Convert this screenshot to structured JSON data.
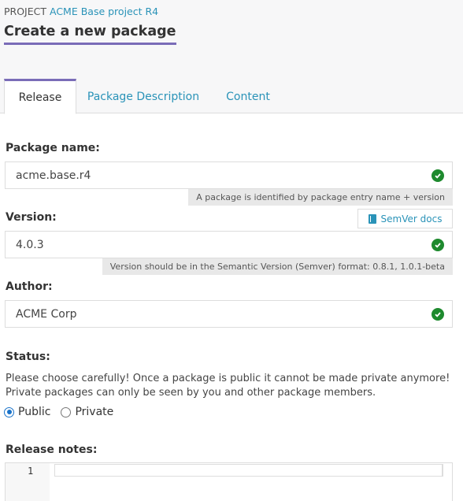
{
  "header": {
    "project_prefix": "PROJECT",
    "project_name": "ACME Base project R4",
    "title": "Create a new package"
  },
  "tabs": [
    {
      "label": "Release",
      "active": true
    },
    {
      "label": "Package Description",
      "active": false
    },
    {
      "label": "Content",
      "active": false
    }
  ],
  "form": {
    "package_name": {
      "label": "Package name:",
      "value": "acme.base.r4",
      "hint": "A package is identified by package entry name + version"
    },
    "version": {
      "label": "Version:",
      "value": "4.0.3",
      "hint": "Version should be in the Semantic Version (Semver) format: 0.8.1, 1.0.1-beta",
      "docs_button": "SemVer docs"
    },
    "author": {
      "label": "Author:",
      "value": "ACME Corp"
    },
    "status": {
      "label": "Status:",
      "description_line1": "Please choose carefully! Once a package is public it cannot be made private anymore!",
      "description_line2": "Private packages can only be seen by you and other package members.",
      "options": [
        {
          "label": "Public",
          "selected": true
        },
        {
          "label": "Private",
          "selected": false
        }
      ]
    },
    "release_notes": {
      "label": "Release notes:",
      "line_number": "1",
      "value": ""
    }
  },
  "colors": {
    "accent": "#7a6cb8",
    "link": "#2a93b8",
    "valid": "#1e8a2e",
    "radio_selected": "#1a73c9"
  }
}
